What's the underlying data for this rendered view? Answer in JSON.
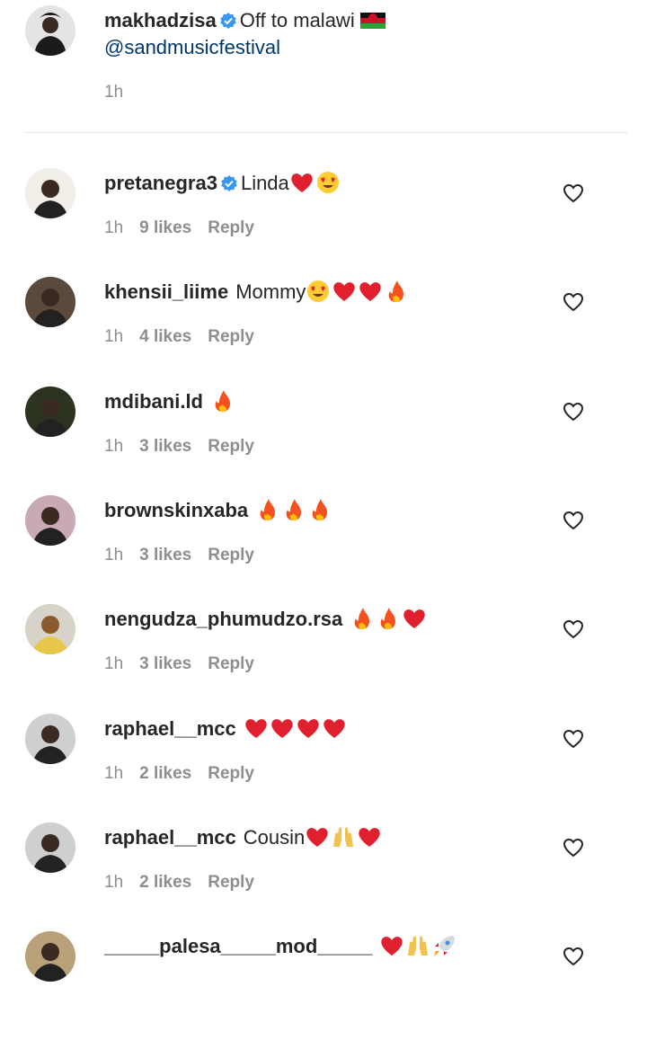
{
  "post": {
    "username": "makhadzisa",
    "caption": "Off to malawi",
    "mention": "@sandmusicfestival",
    "time": "1h"
  },
  "reply_label": "Reply",
  "comments": [
    {
      "username": "pretanegra3",
      "verified": true,
      "text": "Linda",
      "emojis": [
        "heart",
        "heart-eyes"
      ],
      "time": "1h",
      "likes": "9 likes",
      "avatar_color": "#f1efe8"
    },
    {
      "username": "khensii_liime",
      "verified": false,
      "text": "Mommy",
      "emojis": [
        "heart-eyes",
        "heart",
        "heart",
        "fire"
      ],
      "time": "1h",
      "likes": "4 likes",
      "avatar_color": "#5b4a3c"
    },
    {
      "username": "mdibani.ld",
      "verified": false,
      "text": "",
      "emojis": [
        "fire"
      ],
      "time": "1h",
      "likes": "3 likes",
      "avatar_color": "#2c3320"
    },
    {
      "username": "brownskinxaba",
      "verified": false,
      "text": "",
      "emojis": [
        "fire",
        "fire",
        "fire"
      ],
      "time": "1h",
      "likes": "3 likes",
      "avatar_color": "#c9a9b4"
    },
    {
      "username": "nengudza_phumudzo.rsa",
      "verified": false,
      "text": "",
      "emojis": [
        "fire",
        "fire",
        "heart"
      ],
      "time": "1h",
      "likes": "3 likes",
      "avatar_color": "#d8d3c8"
    },
    {
      "username": "raphael__mcc",
      "verified": false,
      "text": "",
      "emojis": [
        "heart",
        "heart",
        "heart",
        "heart"
      ],
      "time": "1h",
      "likes": "2 likes",
      "avatar_color": "#cfcfcf"
    },
    {
      "username": "raphael__mcc",
      "verified": false,
      "text": "Cousin",
      "emojis": [
        "heart",
        "raised-hands",
        "heart"
      ],
      "time": "1h",
      "likes": "2 likes",
      "avatar_color": "#cfcfcf"
    },
    {
      "username": "_____palesa_____mod_____",
      "verified": false,
      "text": "",
      "emojis": [
        "heart",
        "raised-hands",
        "rocket"
      ],
      "time": "",
      "likes": "",
      "avatar_color": "#b9a27a"
    }
  ],
  "icons": {
    "verified": "verified-badge-icon",
    "like": "heart-outline-icon",
    "flag": "malawi-flag-icon"
  },
  "colors": {
    "mention": "#00376b",
    "verified": "#3897f0",
    "muted": "#8e8e8e"
  }
}
